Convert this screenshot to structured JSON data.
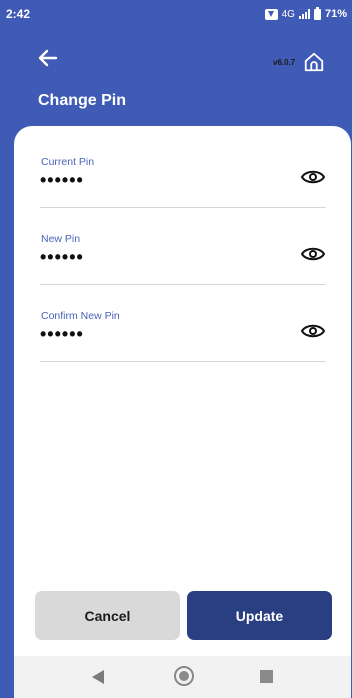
{
  "status_bar": {
    "time": "2:42",
    "network": "4G",
    "battery": "71%"
  },
  "header": {
    "version": "v6.0.7",
    "title": "Change Pin"
  },
  "form": {
    "fields": [
      {
        "label": "Current Pin",
        "value": "••••••"
      },
      {
        "label": "New Pin",
        "value": "••••••"
      },
      {
        "label": "Confirm New Pin",
        "value": "••••••"
      }
    ]
  },
  "actions": {
    "cancel_label": "Cancel",
    "update_label": "Update"
  },
  "colors": {
    "header_bg": "#3f5bb5",
    "label": "#4a63b8",
    "update_bg": "#2a3f82",
    "cancel_bg": "#d9d9d9"
  },
  "icons": [
    "back-arrow-icon",
    "home-icon",
    "eye-icon",
    "nav-back-icon",
    "nav-home-icon",
    "nav-recent-icon"
  ]
}
